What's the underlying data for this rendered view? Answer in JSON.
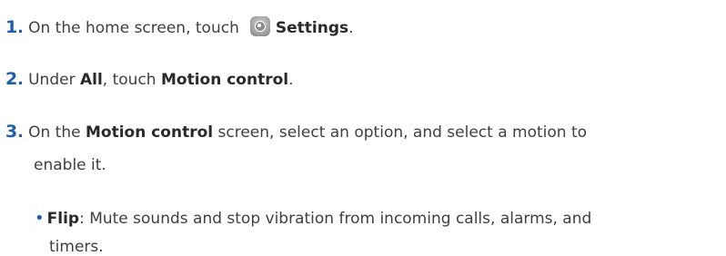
{
  "steps": [
    {
      "number": "1",
      "dot": ".",
      "text_before": "On the home screen, touch",
      "icon": "settings-icon",
      "bold": "Settings",
      "text_after": "."
    },
    {
      "number": "2",
      "dot": ".",
      "text_before": "Under",
      "bold1": "All",
      "text_mid": ", touch",
      "bold2": "Motion control",
      "text_after": "."
    },
    {
      "number": "3",
      "dot": ".",
      "text_before": "On the",
      "bold": "Motion control",
      "text_after": "screen, select an option, and select a motion to",
      "continuation": "enable it."
    }
  ],
  "bullets": [
    {
      "bold": "Flip",
      "text": ": Mute sounds and stop vibration from incoming calls, alarms, and",
      "continuation": "timers."
    }
  ],
  "colors": {
    "number": "#1f5fa8",
    "text": "#3f3f3f"
  }
}
